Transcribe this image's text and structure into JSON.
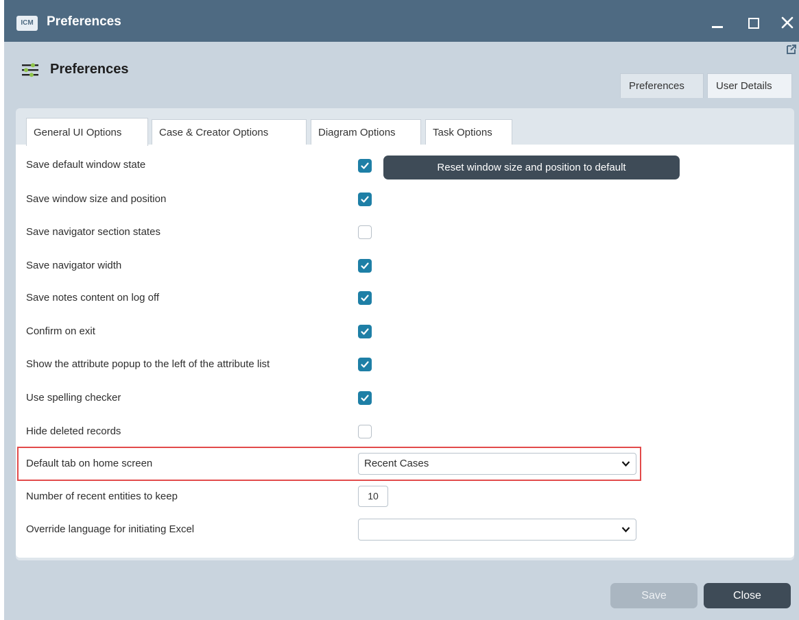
{
  "window": {
    "app_badge": "ICM",
    "title": "Preferences"
  },
  "header": {
    "title": "Preferences"
  },
  "top_tabs": [
    {
      "label": "Preferences",
      "active": true
    },
    {
      "label": "User Details",
      "active": false
    }
  ],
  "inner_tabs": [
    {
      "label": "General UI Options",
      "active": true
    },
    {
      "label": "Case & Creator Options",
      "active": false
    },
    {
      "label": "Diagram Options",
      "active": false
    },
    {
      "label": "Task Options",
      "active": false
    }
  ],
  "reset_button": {
    "label": "Reset window size and position to default"
  },
  "options": [
    {
      "label": "Save default window state",
      "checked": true
    },
    {
      "label": "Save window size and position",
      "checked": true
    },
    {
      "label": "Save navigator section states",
      "checked": false
    },
    {
      "label": "Save navigator width",
      "checked": true
    },
    {
      "label": "Save notes content on log off",
      "checked": true
    },
    {
      "label": "Confirm on exit",
      "checked": true
    },
    {
      "label": "Show the attribute popup to the left of the attribute list",
      "checked": true
    },
    {
      "label": "Use spelling checker",
      "checked": true
    },
    {
      "label": "Hide deleted records",
      "checked": false
    }
  ],
  "default_tab": {
    "label": "Default tab on home screen",
    "value": "Recent Cases"
  },
  "recent_entities": {
    "label": "Number of recent entities to keep",
    "value": "10"
  },
  "excel_language": {
    "label": "Override language for initiating Excel",
    "value": ""
  },
  "footer": {
    "save_label": "Save",
    "close_label": "Close"
  },
  "colors": {
    "titlebar": "#4e6a82",
    "checkbox_on": "#1e7fa6",
    "dark_button": "#3e4b57",
    "highlight": "#e24a4a"
  }
}
